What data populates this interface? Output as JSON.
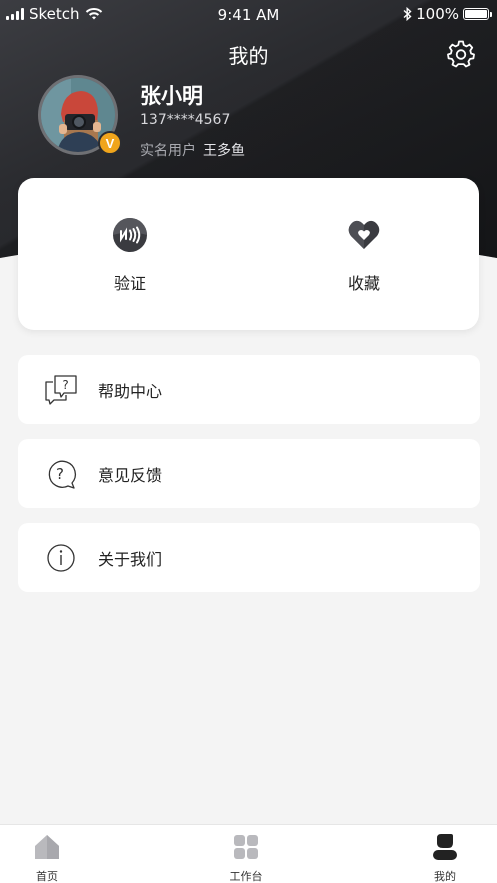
{
  "status_bar": {
    "carrier": "Sketch",
    "time": "9:41 AM",
    "battery": "100%"
  },
  "header": {
    "title": "我的"
  },
  "profile": {
    "name": "张小明",
    "phone": "137****4567",
    "real_name_label": "实名用户",
    "real_name_value": "王多鱼",
    "badge": "V"
  },
  "actions": [
    {
      "label": "验证",
      "icon": "nfc-icon"
    },
    {
      "label": "收藏",
      "icon": "heart-icon"
    }
  ],
  "menu": [
    {
      "label": "帮助中心",
      "icon": "help-chat-icon"
    },
    {
      "label": "意见反馈",
      "icon": "feedback-question-icon"
    },
    {
      "label": "关于我们",
      "icon": "info-icon"
    }
  ],
  "tabs": [
    {
      "label": "首页",
      "icon": "home-icon"
    },
    {
      "label": "工作台",
      "icon": "grid-icon"
    },
    {
      "label": "我的",
      "icon": "person-icon",
      "active": true
    }
  ],
  "colors": {
    "header_dark": "#2a2b2f",
    "vip_badge": "#f0a51c",
    "page_bg": "#f4f4f4"
  }
}
